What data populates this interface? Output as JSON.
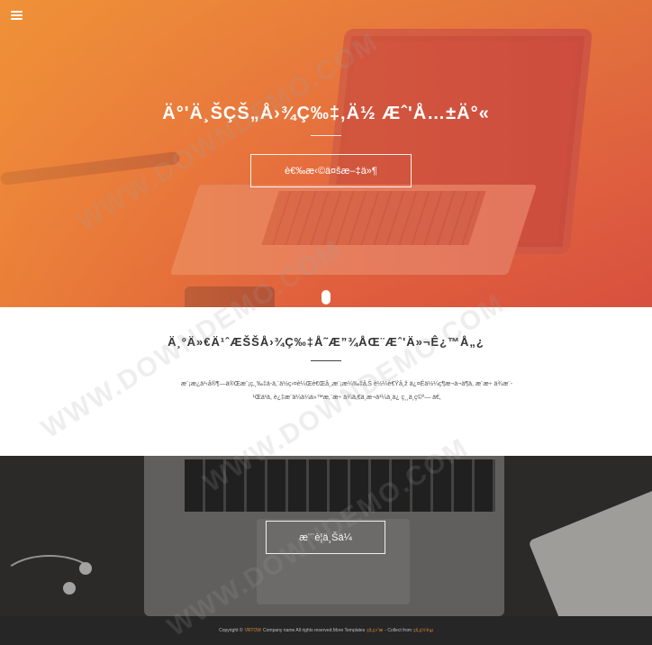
{
  "hero": {
    "title": "Ä°'Ä¸ŠÇŠ„Å›¾Ç‰‡‚Ä½ Æˆ'Å…±Ä°«",
    "button_label": "è€‰æ‹©ä¤šæ–‡ä»¶"
  },
  "about": {
    "title": "Ä¸ºÄ»€Ä¹ˆÆŠŠÅ›¾Ç‰‡Å˜Æ”¾ÅŒ¨Æˆ'Ä»¬Ê¿™Å„¿",
    "paragraph": "æ¨¡æ¿ä¹‹å®¶—ä®Œæ¨¡ç‚¸‰‡ä-ä,¨ä½ç›¤è¼Œè€Œå¸‚æ¨¡æ¼‰‡å‚Š è½¼è€Ÿå¸ž ä¿¤Éä½¼ç¶æ¬ä¬ä¶ä,   æ¨æ÷   ä¾æ¨-¹Œä¹ä,    è¿‡æ¨ä¼ä¼ä»™æ,¨æ÷   ä¾ä,€ä¸æ¬ä¹¼ä¸ä¿   ç¸¸ä¸ç©º—   ä€‚"
  },
  "bottom": {
    "button_label": "æ¨¨è¦ä¸Šä¼"
  },
  "footer": {
    "copyright_prefix": "Copyright ©",
    "brand": "VRTOW",
    "copyright_suffix": "Company name All rights reserved.More Templates",
    "templates_link": "çš„ç»“æ",
    "collect_text": "- Collect from",
    "collect_link": "çš„ç½‘é¡µ"
  },
  "watermark": {
    "text": "WWW.DOWNDEMO.COM"
  }
}
